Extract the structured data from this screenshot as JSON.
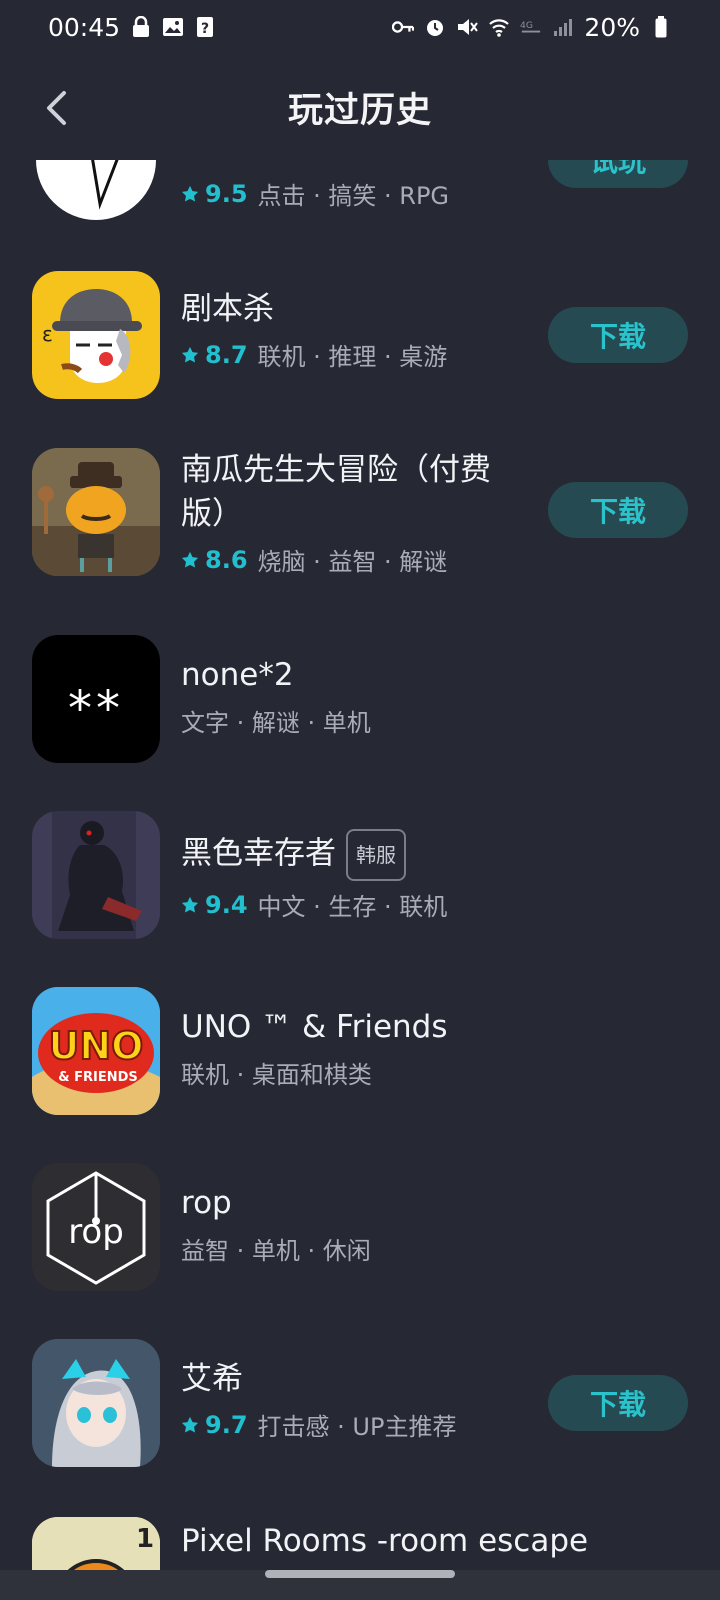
{
  "status": {
    "time": "00:45",
    "battery": "20%",
    "icons_left": [
      "lock-icon",
      "image-icon",
      "question-icon"
    ],
    "icons_right": [
      "key-icon",
      "alarm-icon",
      "mute-icon",
      "wifi-icon",
      "volte-icon",
      "signal-icon",
      "battery-icon"
    ]
  },
  "header": {
    "title": "玩过历史",
    "back_icon": "chevron-left-icon"
  },
  "apps": [
    {
      "name": "",
      "rating": "9.5",
      "tags": "点击 · 搞笑 · RPG",
      "button": "试玩"
    },
    {
      "name": "剧本杀",
      "rating": "8.7",
      "tags": "联机 · 推理 · 桌游",
      "button": "下载"
    },
    {
      "name": "南瓜先生大冒险（付费版）",
      "rating": "8.6",
      "tags": "烧脑 · 益智 · 解谜",
      "button": "下载"
    },
    {
      "name": "none*2",
      "rating": "",
      "tags": "文字 · 解谜 · 单机",
      "button": "",
      "icon_text": "**"
    },
    {
      "name": "黑色幸存者",
      "badge": "韩服",
      "rating": "9.4",
      "tags": "中文 · 生存 · 联机",
      "button": ""
    },
    {
      "name": "UNO ™ & Friends",
      "rating": "",
      "tags": "联机 · 桌面和棋类",
      "button": "",
      "icon_text": "UNO",
      "icon_subtext": "& FRIENDS"
    },
    {
      "name": "rop",
      "rating": "",
      "tags": "益智 · 单机 · 休闲",
      "button": "",
      "icon_text": "rop"
    },
    {
      "name": "艾希",
      "rating": "9.7",
      "tags": "打击感 · UP主推荐",
      "button": "下载"
    },
    {
      "name": "Pixel Rooms -room escape",
      "rating": "",
      "tags": "",
      "button": "",
      "icon_text": "1"
    }
  ],
  "colors": {
    "background": "#262833",
    "accent": "#22c0cf",
    "button_bg": "#264a52"
  }
}
